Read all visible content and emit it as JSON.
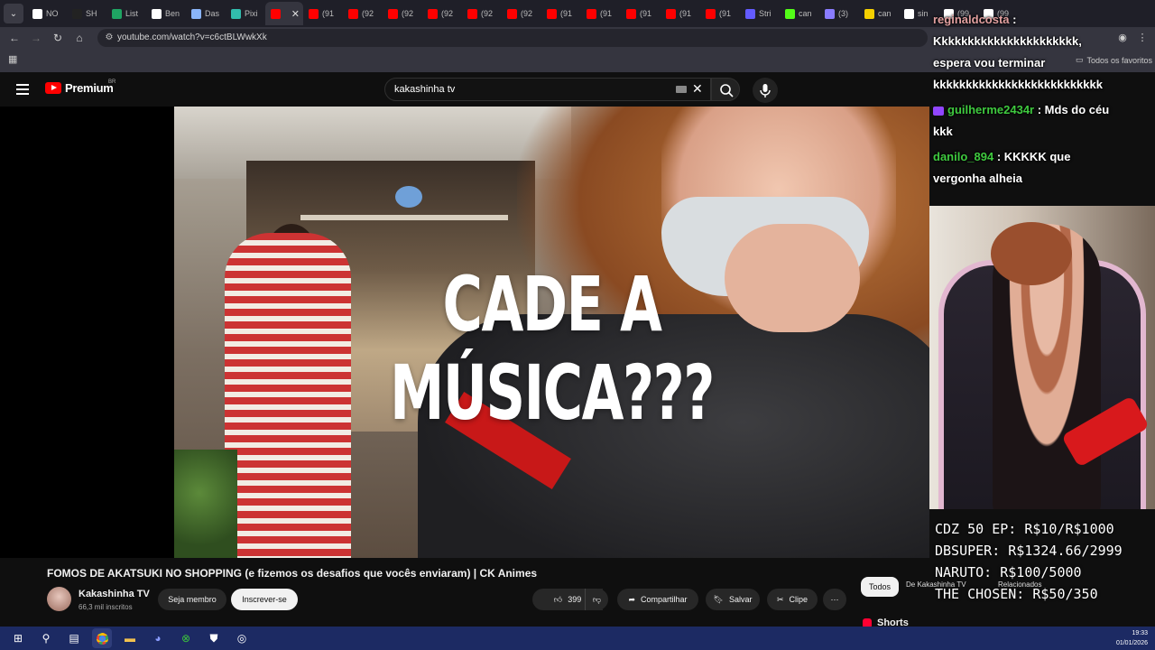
{
  "browser": {
    "tabs": [
      {
        "label": "NO",
        "icon": "notion-icon",
        "color": "#ffffff"
      },
      {
        "label": "SH",
        "icon": "shopify-icon",
        "color": "#222222"
      },
      {
        "label": "List",
        "icon": "sheets-icon",
        "color": "#1fa463"
      },
      {
        "label": "Ben",
        "icon": "notion-icon",
        "color": "#ffffff"
      },
      {
        "label": "Das",
        "icon": "globe-icon",
        "color": "#8ab4f8"
      },
      {
        "label": "Pixi",
        "icon": "pix-icon",
        "color": "#32bcad"
      },
      {
        "label": "",
        "icon": "youtube-icon",
        "color": "#ff0000",
        "active": true
      },
      {
        "label": "(91",
        "icon": "youtube-icon",
        "color": "#ff0000"
      },
      {
        "label": "(92",
        "icon": "youtube-icon",
        "color": "#ff0000"
      },
      {
        "label": "(92",
        "icon": "youtube-icon",
        "color": "#ff0000"
      },
      {
        "label": "(92",
        "icon": "youtube-icon",
        "color": "#ff0000"
      },
      {
        "label": "(92",
        "icon": "youtube-icon",
        "color": "#ff0000"
      },
      {
        "label": "(92",
        "icon": "youtube-icon",
        "color": "#ff0000"
      },
      {
        "label": "(91",
        "icon": "youtube-icon",
        "color": "#ff0000"
      },
      {
        "label": "(91",
        "icon": "youtube-icon",
        "color": "#ff0000"
      },
      {
        "label": "(91",
        "icon": "youtube-icon",
        "color": "#ff0000"
      },
      {
        "label": "(91",
        "icon": "youtube-icon",
        "color": "#ff0000"
      },
      {
        "label": "(91",
        "icon": "youtube-icon",
        "color": "#ff0000"
      },
      {
        "label": "Stri",
        "icon": "stripe-icon",
        "color": "#635bff"
      },
      {
        "label": "can",
        "icon": "kick-icon",
        "color": "#53fc18"
      },
      {
        "label": "(3)",
        "icon": "discord-icon",
        "color": "#8a7cff"
      },
      {
        "label": "can",
        "icon": "yellow-icon",
        "color": "#f5d000"
      },
      {
        "label": "sin",
        "icon": "google-icon",
        "color": "#ffffff"
      },
      {
        "label": "(99",
        "icon": "tiktok-icon",
        "color": "#ffffff"
      },
      {
        "label": "(99",
        "icon": "tiktok-icon",
        "color": "#ffffff"
      }
    ],
    "tab_menu_label": "⌄",
    "close_tab": "✕",
    "url": "youtube.com/watch?v=c6ctBLWwkXk",
    "bookmarks_folder": "Todos os favoritos"
  },
  "youtube": {
    "logo_text": "Premium",
    "country": "BR",
    "search_value": "kakashinha tv",
    "video_caption": "CADE A MÚSICA???",
    "title": "FOMOS DE AKATSUKI NO SHOPPING (e fizemos os desafios que vocês enviaram) | CK Animes",
    "channel": {
      "name": "Kakashinha TV",
      "subs": "66,3 mil inscritos"
    },
    "join_label": "Seja membro",
    "subscribe_label": "Inscrever-se",
    "likes": "399",
    "share_label": "Compartilhar",
    "save_label": "Salvar",
    "clip_label": "Clipe",
    "chips": {
      "all": "Todos",
      "channel": "De Kakashinha TV",
      "related": "Relacionados"
    },
    "shorts_label": "Shorts"
  },
  "stream_overlay": {
    "chat": [
      {
        "user": "reginaldcosta",
        "text": ":"
      },
      {
        "user": "",
        "text": "Kkkkkkkkkkkkkkkkkkkkkk,"
      },
      {
        "user": "",
        "text": "espera vou terminar"
      },
      {
        "user": "",
        "text": "kkkkkkkkkkkkkkkkkkkkkkkkkk"
      },
      {
        "user": "guilherme2434r",
        "text": ": Mds do céu"
      },
      {
        "user": "",
        "text": "kkk"
      },
      {
        "user": "danilo_894",
        "text": ": KKKKK que"
      },
      {
        "user": "",
        "text": "vergonha alheia"
      }
    ],
    "meta_lines": [
      "CDZ 50 EP: R$10/R$1000",
      "DBSUPER: R$1324.66/2999",
      "NARUTO: R$100/5000",
      "THE CHOSEN: R$50/350"
    ]
  },
  "taskbar": {
    "time": "19:33",
    "date": "01/01/2026"
  }
}
